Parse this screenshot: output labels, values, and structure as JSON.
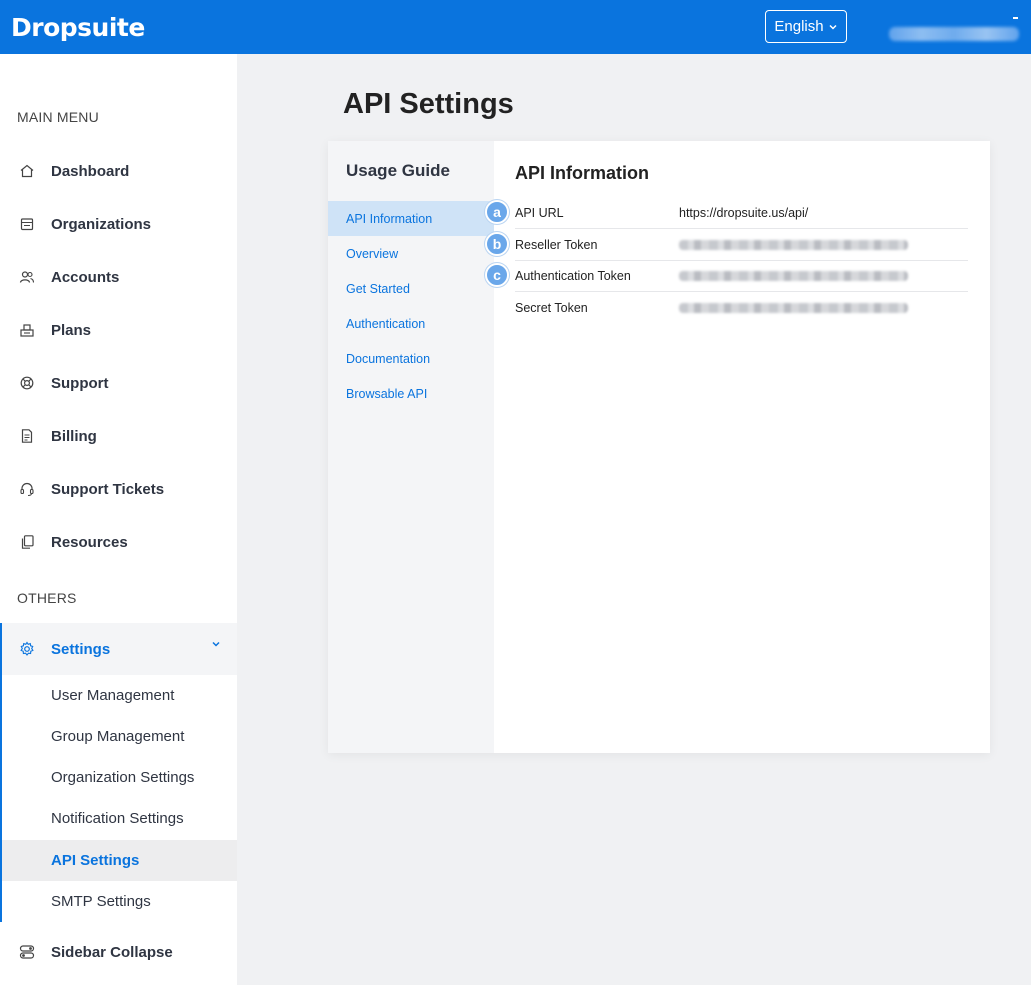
{
  "brand": {
    "logo_text": "Dropsuite"
  },
  "header": {
    "language_label": "English"
  },
  "sidebar": {
    "main_menu_label": "MAIN MENU",
    "items": [
      {
        "label": "Dashboard",
        "icon": "home-icon"
      },
      {
        "label": "Organizations",
        "icon": "building-icon"
      },
      {
        "label": "Accounts",
        "icon": "users-icon"
      },
      {
        "label": "Plans",
        "icon": "plans-icon"
      },
      {
        "label": "Support",
        "icon": "lifebuoy-icon"
      },
      {
        "label": "Billing",
        "icon": "invoice-icon"
      },
      {
        "label": "Support Tickets",
        "icon": "headset-icon"
      },
      {
        "label": "Resources",
        "icon": "copy-icon"
      }
    ],
    "others_label": "OTHERS",
    "settings": {
      "label": "Settings",
      "icon": "gear-icon",
      "expanded": true,
      "sub_items": [
        "User Management",
        "Group Management",
        "Organization Settings",
        "Notification Settings",
        "API Settings",
        "SMTP Settings"
      ],
      "active_sub_item": "API Settings"
    },
    "collapse_label": "Sidebar Collapse"
  },
  "page": {
    "title": "API Settings"
  },
  "usage_guide": {
    "title": "Usage Guide",
    "items": [
      "API Information",
      "Overview",
      "Get Started",
      "Authentication",
      "Documentation",
      "Browsable API"
    ],
    "active": "API Information"
  },
  "api_info": {
    "title": "API Information",
    "rows": [
      {
        "key": "API URL",
        "value": "https://dropsuite.us/api/"
      },
      {
        "key": "Reseller Token",
        "value": ""
      },
      {
        "key": "Authentication Token",
        "value": ""
      },
      {
        "key": "Secret Token",
        "value": ""
      }
    ]
  },
  "callouts": [
    "a",
    "b",
    "c"
  ],
  "colors": {
    "brand_blue": "#0a74de",
    "active_tab_bg": "#cfe3f7",
    "callout_blue": "#6aa7ea"
  }
}
